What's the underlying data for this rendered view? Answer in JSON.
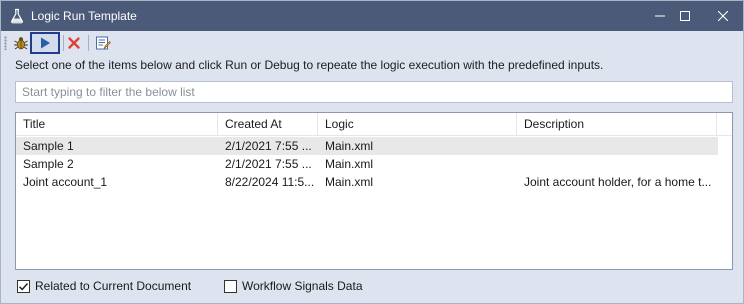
{
  "window": {
    "title": "Logic Run Template",
    "title_icon": "flask-icon"
  },
  "toolbar": {
    "buttons": [
      {
        "name": "debug",
        "icon": "bug-icon"
      },
      {
        "name": "run",
        "icon": "play-icon",
        "active": true
      },
      {
        "name": "delete",
        "icon": "delete-x-icon"
      },
      {
        "name": "edit",
        "icon": "edit-list-icon"
      }
    ]
  },
  "instruction": "Select one of the items below and click Run or Debug to repeate the logic execution with the predefined inputs.",
  "filter": {
    "placeholder": "Start typing to filter the below list",
    "value": ""
  },
  "list": {
    "columns": [
      "Title",
      "Created At",
      "Logic",
      "Description"
    ],
    "rows": [
      {
        "title": "Sample 1",
        "created_at": "2/1/2021 7:55 ...",
        "logic": "Main.xml",
        "description": "",
        "selected": true
      },
      {
        "title": "Sample 2",
        "created_at": "2/1/2021 7:55 ...",
        "logic": "Main.xml",
        "description": "",
        "selected": false
      },
      {
        "title": "Joint account_1",
        "created_at": "8/22/2024 11:5...",
        "logic": "Main.xml",
        "description": "Joint account holder, for a home t...",
        "selected": false
      }
    ]
  },
  "options": {
    "related_label": "Related to Current Document",
    "related_checked": true,
    "workflow_label": "Workflow Signals Data",
    "workflow_checked": false
  },
  "colors": {
    "titlebar": "#4b5a78",
    "window_bg": "#dde3ef",
    "accent_border": "#1f3d8a",
    "play": "#2a5fa8",
    "delete": "#e0403a"
  }
}
